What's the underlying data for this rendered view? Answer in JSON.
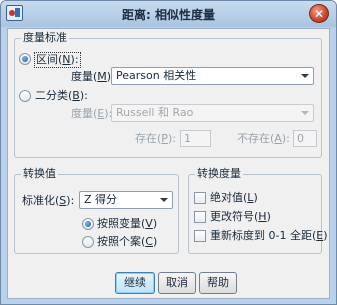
{
  "window": {
    "title": "距离: 相似性度量"
  },
  "measure_group": {
    "legend": "度量标准",
    "interval": {
      "radio_label": "区间",
      "radio_key": "N",
      "selected": true,
      "measure_label": "度量",
      "measure_key": "M",
      "measure_value": "Pearson 相关性"
    },
    "binary": {
      "radio_label": "二分类",
      "radio_key": "B",
      "selected": false,
      "measure_label": "度量",
      "measure_key": "E",
      "measure_value": "Russell 和 Rao",
      "present_label": "存在",
      "present_key": "P",
      "present_value": "1",
      "absent_label": "不存在",
      "absent_key": "A",
      "absent_value": "0"
    }
  },
  "transform_values": {
    "legend": "转换值",
    "standardize_label": "标准化",
    "standardize_key": "S",
    "standardize_value": "Z 得分",
    "by_variable": {
      "label": "按照变量",
      "key": "V",
      "selected": true
    },
    "by_case": {
      "label": "按照个案",
      "key": "C",
      "selected": false
    }
  },
  "transform_measures": {
    "legend": "转换度量",
    "abs": {
      "label": "绝对值",
      "key": "L",
      "checked": false
    },
    "change_sign": {
      "label": "更改符号",
      "key": "H",
      "checked": false
    },
    "rescale": {
      "label": "重新标度到 0-1 全距",
      "key": "E",
      "checked": false
    }
  },
  "buttons": {
    "continue": "继续",
    "cancel": "取消",
    "help": "帮助"
  }
}
